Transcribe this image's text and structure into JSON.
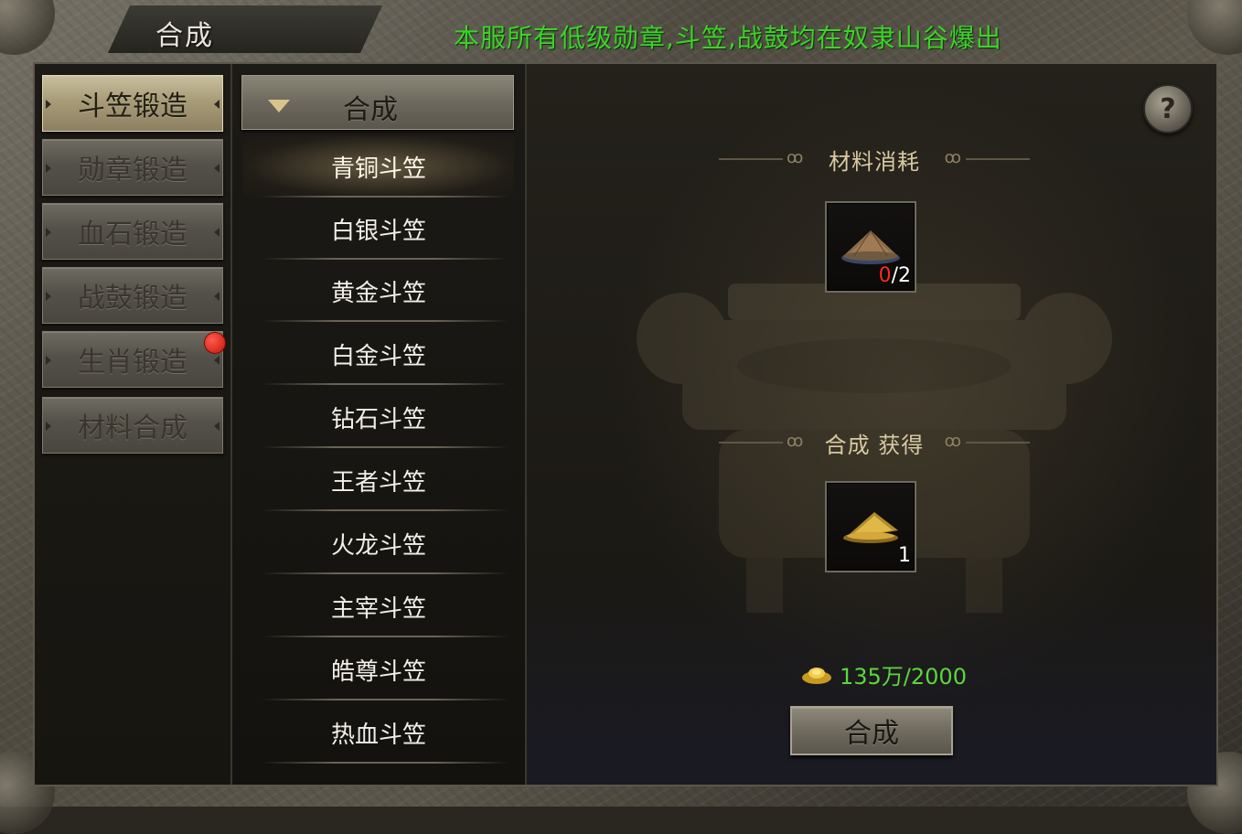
{
  "window": {
    "title": "合成",
    "announcement": "本服所有低级勋章,斗笠,战鼓均在奴隶山谷爆出"
  },
  "left_tabs": [
    {
      "label": "斗笠锻造",
      "active": true,
      "badge": false
    },
    {
      "label": "勋章锻造",
      "active": false,
      "badge": false
    },
    {
      "label": "血石锻造",
      "active": false,
      "badge": false
    },
    {
      "label": "战鼓锻造",
      "active": false,
      "badge": false
    },
    {
      "label": "生肖锻造",
      "active": false,
      "badge": true
    },
    {
      "label": "材料合成",
      "active": false,
      "badge": false
    }
  ],
  "list": {
    "header": "合成",
    "items": [
      "青铜斗笠",
      "白银斗笠",
      "黄金斗笠",
      "白金斗笠",
      "钻石斗笠",
      "王者斗笠",
      "火龙斗笠",
      "主宰斗笠",
      "皓尊斗笠",
      "热血斗笠"
    ],
    "selected_index": 0
  },
  "detail": {
    "help_label": "?",
    "materials_title": "材料消耗",
    "result_title": "合成 获得",
    "material": {
      "owned": "0",
      "required": "/2",
      "icon": "bamboo-hat-icon"
    },
    "result": {
      "count": "1",
      "icon": "gold-hat-icon"
    },
    "cost_value": "135万/2000",
    "cost_icon": "gold-ingot-icon",
    "confirm_label": "合成"
  },
  "colors": {
    "announcement": "#3ed12a",
    "cost": "#5bd63e",
    "badge": "#e02a1c",
    "need_count": "#ff2a1e"
  }
}
